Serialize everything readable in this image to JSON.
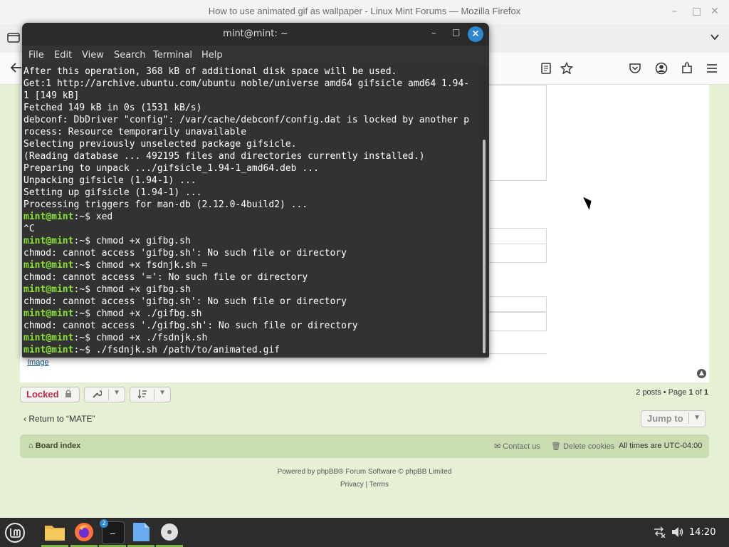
{
  "firefox": {
    "window_title": "How to use animated gif as wallpaper - Linux Mint Forums — Mozilla Firefox",
    "minimize_glyph": "–",
    "maximize_glyph": "□",
    "close_glyph": "✕"
  },
  "forum": {
    "image_link": "Image",
    "locked_label": "Locked",
    "pagination_prefix": "2 posts • Page ",
    "pagination_current": "1",
    "pagination_of": " of ",
    "pagination_total": "1",
    "return_link": "Return to “MATE”",
    "jump_to": "Jump to",
    "board_index": "Board index",
    "contact_us": "Contact us",
    "delete_cookies": "Delete cookies",
    "timezone": "All times are UTC-04:00",
    "powered_by": "Powered by phpBB® Forum Software © phpBB Limited",
    "privacy": "Privacy",
    "terms": "Terms",
    "footer_sep": " | "
  },
  "terminal": {
    "title": "mint@mint: ~",
    "menu": [
      "File",
      "Edit",
      "View",
      "Search",
      "Terminal",
      "Help"
    ],
    "prompt_user": "mint@mint",
    "prompt_sep": ":~$ ",
    "lines": [
      {
        "t": "out",
        "text": "After this operation, 368 kB of additional disk space will be used."
      },
      {
        "t": "out",
        "text": "Get:1 http://archive.ubuntu.com/ubuntu noble/universe amd64 gifsicle amd64 1.94-"
      },
      {
        "t": "out",
        "text": "1 [149 kB]"
      },
      {
        "t": "out",
        "text": "Fetched 149 kB in 0s (1531 kB/s)"
      },
      {
        "t": "out",
        "text": "debconf: DbDriver \"config\": /var/cache/debconf/config.dat is locked by another p"
      },
      {
        "t": "out",
        "text": "rocess: Resource temporarily unavailable"
      },
      {
        "t": "out",
        "text": "Selecting previously unselected package gifsicle."
      },
      {
        "t": "out",
        "text": "(Reading database ... 492195 files and directories currently installed.)"
      },
      {
        "t": "out",
        "text": "Preparing to unpack .../gifsicle_1.94-1_amd64.deb ..."
      },
      {
        "t": "out",
        "text": "Unpacking gifsicle (1.94-1) ..."
      },
      {
        "t": "out",
        "text": "Setting up gifsicle (1.94-1) ..."
      },
      {
        "t": "out",
        "text": "Processing triggers for man-db (2.12.0-4build2) ..."
      },
      {
        "t": "cmd",
        "text": "xed"
      },
      {
        "t": "out",
        "text": "^C"
      },
      {
        "t": "cmd",
        "text": "chmod +x gifbg.sh"
      },
      {
        "t": "out",
        "text": "chmod: cannot access 'gifbg.sh': No such file or directory"
      },
      {
        "t": "cmd",
        "text": "chmod +x fsdnjk.sh ="
      },
      {
        "t": "out",
        "text": "chmod: cannot access '=': No such file or directory"
      },
      {
        "t": "cmd",
        "text": "chmod +x gifbg.sh"
      },
      {
        "t": "out",
        "text": "chmod: cannot access 'gifbg.sh': No such file or directory"
      },
      {
        "t": "cmd",
        "text": "chmod +x ./gifbg.sh"
      },
      {
        "t": "out",
        "text": "chmod: cannot access './gifbg.sh': No such file or directory"
      },
      {
        "t": "cmd",
        "text": "chmod +x ./fsdnjk.sh"
      },
      {
        "t": "cmd",
        "text": "./fsdnjk.sh /path/to/animated.gif"
      }
    ]
  },
  "taskbar": {
    "clock": "14:20",
    "terminal_badge": "2",
    "terminal_glyph": "_"
  },
  "colors": {
    "prompt_green": "#8ae234",
    "locked_red": "#bc2a4d",
    "forum_bg": "#e6f0d4",
    "navbar_green": "#cadcb2",
    "close_blue": "#2d88d1"
  }
}
